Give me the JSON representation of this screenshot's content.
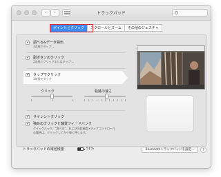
{
  "window": {
    "title": "トラックパッド",
    "nav_back": "‹",
    "nav_forward": "›"
  },
  "tabs": [
    {
      "label": "ポイントとクリック",
      "active": true
    },
    {
      "label": "スクロールとズーム",
      "active": false
    },
    {
      "label": "その他のジェスチャ",
      "active": false
    }
  ],
  "options": [
    {
      "label": "調べる&データ検出",
      "sub": "3本指でタップ ⌄",
      "checked": true
    },
    {
      "label": "副ボタンのクリック",
      "sub": "2本指でクリックまたはタップ ⌄",
      "checked": true
    },
    {
      "label": "タップでクリック",
      "sub": "1本指でタップ",
      "checked": true
    }
  ],
  "sliders": {
    "click_label": "クリック",
    "click_value_fraction": 0.5,
    "tracking_label": "軌跡の速さ",
    "tracking_value_fraction": 0.55
  },
  "silent_click": {
    "label": "サイレントクリック",
    "checked": true
  },
  "force_click": {
    "label": "強めのクリックと触覚フィードバック",
    "note": "クイックルック、\"調べる\"、および可変速度メディアコントロールの場合は、クリックしてから強く押します。",
    "checked": true
  },
  "battery": {
    "label": "トラックパッドの電池残量",
    "percent_text": "51%",
    "level_fraction": 0.51
  },
  "bluetooth_button": "Bluetoothトラックパッドを設定...",
  "help_label": "?",
  "colors": {
    "accent": "#3d8af7",
    "highlight": "#e0242c"
  }
}
